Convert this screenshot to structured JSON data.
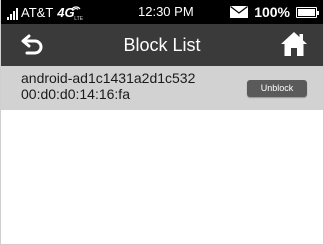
{
  "status_bar": {
    "carrier": "AT&T",
    "network": "4G",
    "network_sub": "LTE",
    "time": "12:30 PM",
    "battery_percent": "100%",
    "battery_level": 1.0,
    "icons": [
      "signal-bars-icon",
      "wifi-signal-icon",
      "mail-icon",
      "battery-icon"
    ]
  },
  "header": {
    "title": "Block List",
    "back_icon": "back-arrow-icon",
    "home_icon": "home-icon"
  },
  "block_list": {
    "items": [
      {
        "device_name": "android-ad1c1431a2d1c532",
        "mac_address": "00:d0:d0:14:16:fa",
        "action_label": "Unblock"
      }
    ]
  },
  "colors": {
    "status_bar_bg": "#000000",
    "header_bg": "#3a3a3a",
    "row_bg": "#d2d2d2",
    "button_bg": "#5a5a5a"
  }
}
